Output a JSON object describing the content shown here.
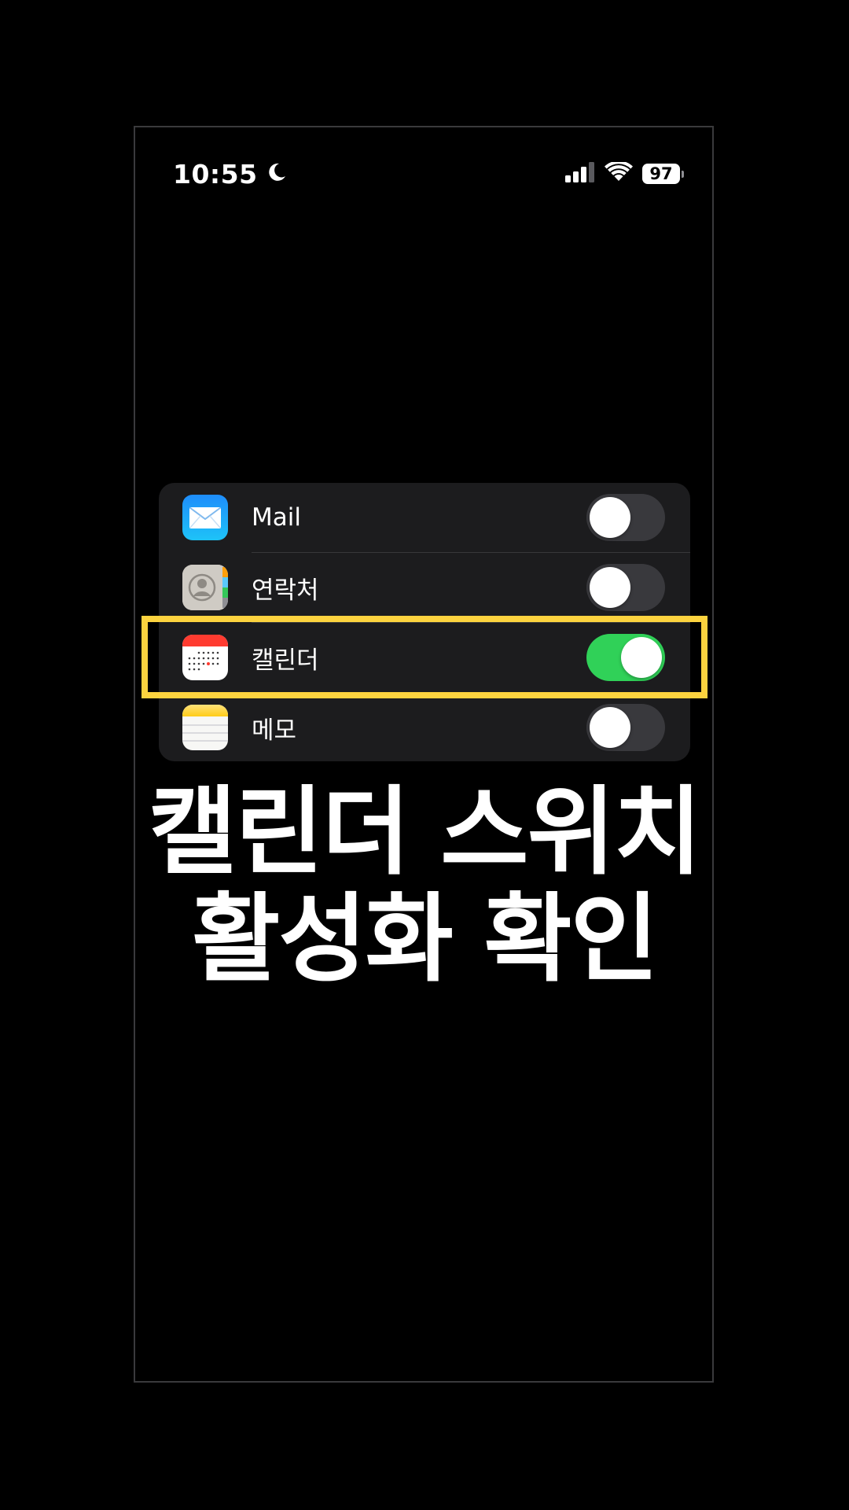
{
  "status_bar": {
    "time": "10:55",
    "battery_level": "97",
    "icons": [
      "moon-icon",
      "cellular-signal-icon",
      "wifi-icon",
      "battery-icon"
    ]
  },
  "settings": {
    "items": [
      {
        "label": "Mail",
        "icon": "mail-app-icon",
        "enabled": false
      },
      {
        "label": "연락처",
        "icon": "contacts-app-icon",
        "enabled": false
      },
      {
        "label": "캘린더",
        "icon": "calendar-app-icon",
        "enabled": true
      },
      {
        "label": "메모",
        "icon": "notes-app-icon",
        "enabled": false
      }
    ]
  },
  "caption": {
    "line1": "캘린더 스위치",
    "line2": "활성화 확인"
  },
  "colors": {
    "background": "#000000",
    "card": "#1c1c1e",
    "toggle_on": "#30d158",
    "toggle_off": "#39393d",
    "highlight": "#fcd33f"
  }
}
